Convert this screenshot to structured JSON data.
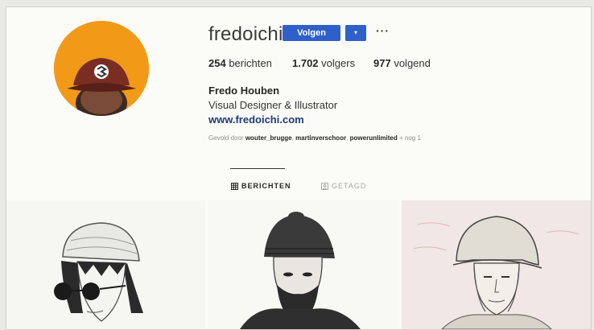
{
  "profile": {
    "username": "fredoichi",
    "follow_label": "Volgen",
    "dropdown_glyph": "▾",
    "more_glyph": "···",
    "full_name": "Fredo Houben",
    "bio": "Visual Designer & Illustrator",
    "website": "www.fredoichi.com"
  },
  "stats": {
    "posts_count": "254",
    "posts_label": "berichten",
    "followers_count": "1.702",
    "followers_label": "volgers",
    "following_count": "977",
    "following_label": "volgend"
  },
  "followed_by": {
    "prefix": "Gevold door",
    "accounts": [
      "wouter_brugge",
      "martinverschoor",
      "powerunlimited"
    ],
    "suffix": "+ nog 1"
  },
  "tabs": [
    {
      "label": "BERICHTEN",
      "icon": "grid-icon",
      "active": true
    },
    {
      "label": "GETAGD",
      "icon": "tag-icon",
      "active": false
    }
  ],
  "posts": [
    {
      "subject": "illustration-girl-sunglasses-beanie"
    },
    {
      "subject": "illustration-bearded-man-beanie"
    },
    {
      "subject": "illustration-soldier-helmet"
    }
  ],
  "colors": {
    "accent": "#2f5fc9",
    "avatar_bg": "#f29a17",
    "link": "#1c3a7a"
  }
}
